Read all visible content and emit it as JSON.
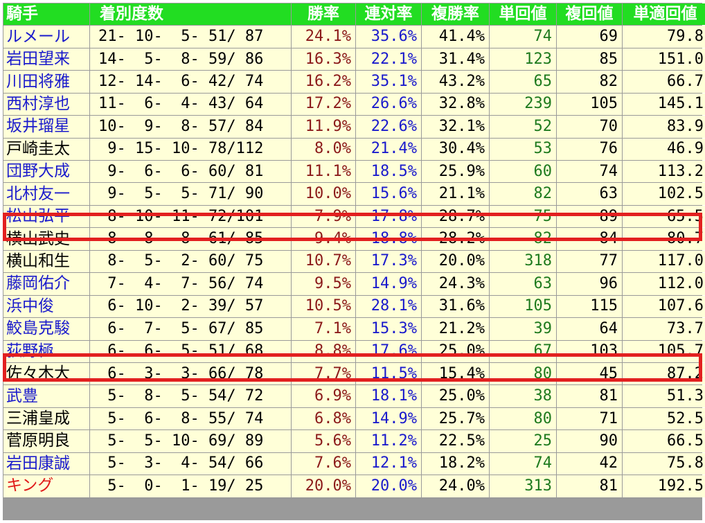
{
  "headers": [
    "騎手",
    "着別度数",
    "勝率",
    "連対率",
    "複勝率",
    "単回値",
    "複回値",
    "単適回値"
  ],
  "colors": {
    "header_bg": "#22dd22",
    "cell_bg": "#ffffd8",
    "highlight": "#e22020",
    "name_blue": "#1a1acc",
    "name_black": "#000000",
    "name_red": "#e01a1a",
    "win_rate": "#8b1a1a",
    "place_rate": "#1a1acc",
    "tan_return": "#1e7a1e"
  },
  "rows": [
    {
      "name": "ルメール",
      "name_color": "blue",
      "record": "21- 10-  5- 51/ 87",
      "win": "24.1%",
      "place": "35.6%",
      "show": "41.4%",
      "tan": "74",
      "fuku": "69",
      "adj": "79.8"
    },
    {
      "name": "岩田望来",
      "name_color": "blue",
      "record": "14-  5-  8- 59/ 86",
      "win": "16.3%",
      "place": "22.1%",
      "show": "31.4%",
      "tan": "123",
      "fuku": "85",
      "adj": "151.0"
    },
    {
      "name": "川田将雅",
      "name_color": "blue",
      "record": "12- 14-  6- 42/ 74",
      "win": "16.2%",
      "place": "35.1%",
      "show": "43.2%",
      "tan": "65",
      "fuku": "82",
      "adj": "66.7"
    },
    {
      "name": "西村淳也",
      "name_color": "blue",
      "record": "11-  6-  4- 43/ 64",
      "win": "17.2%",
      "place": "26.6%",
      "show": "32.8%",
      "tan": "239",
      "fuku": "105",
      "adj": "145.1"
    },
    {
      "name": "坂井瑠星",
      "name_color": "blue",
      "record": "10-  9-  8- 57/ 84",
      "win": "11.9%",
      "place": "22.6%",
      "show": "32.1%",
      "tan": "52",
      "fuku": "70",
      "adj": "83.9"
    },
    {
      "name": "戸崎圭太",
      "name_color": "black",
      "record": " 9- 15- 10- 78/112",
      "win": "8.0%",
      "place": "21.4%",
      "show": "30.4%",
      "tan": "53",
      "fuku": "76",
      "adj": "46.9"
    },
    {
      "name": "団野大成",
      "name_color": "blue",
      "record": " 9-  6-  6- 60/ 81",
      "win": "11.1%",
      "place": "18.5%",
      "show": "25.9%",
      "tan": "60",
      "fuku": "74",
      "adj": "113.2"
    },
    {
      "name": "北村友一",
      "name_color": "blue",
      "record": " 9-  5-  5- 71/ 90",
      "win": "10.0%",
      "place": "15.6%",
      "show": "21.1%",
      "tan": "82",
      "fuku": "63",
      "adj": "102.5"
    },
    {
      "name": "松山弘平",
      "name_color": "blue",
      "record": " 8- 10- 11- 72/101",
      "win": "7.9%",
      "place": "17.8%",
      "show": "28.7%",
      "tan": "75",
      "fuku": "89",
      "adj": "65.5"
    },
    {
      "name": "横山武史",
      "name_color": "black",
      "record": " 8-  8-  8- 61/ 85",
      "win": "9.4%",
      "place": "18.8%",
      "show": "28.2%",
      "tan": "82",
      "fuku": "84",
      "adj": "80.7"
    },
    {
      "name": "横山和生",
      "name_color": "black",
      "record": " 8-  5-  2- 60/ 75",
      "win": "10.7%",
      "place": "17.3%",
      "show": "20.0%",
      "tan": "318",
      "fuku": "77",
      "adj": "117.0"
    },
    {
      "name": "藤岡佑介",
      "name_color": "blue",
      "record": " 7-  4-  7- 56/ 74",
      "win": "9.5%",
      "place": "14.9%",
      "show": "24.3%",
      "tan": "63",
      "fuku": "96",
      "adj": "112.0"
    },
    {
      "name": "浜中俊",
      "name_color": "blue",
      "record": " 6- 10-  2- 39/ 57",
      "win": "10.5%",
      "place": "28.1%",
      "show": "31.6%",
      "tan": "105",
      "fuku": "115",
      "adj": "107.6"
    },
    {
      "name": "鮫島克駿",
      "name_color": "blue",
      "record": " 6-  7-  5- 67/ 85",
      "win": "7.1%",
      "place": "15.3%",
      "show": "21.2%",
      "tan": "39",
      "fuku": "64",
      "adj": "73.7"
    },
    {
      "name": "荻野極",
      "name_color": "blue",
      "record": " 6-  6-  5- 51/ 68",
      "win": "8.8%",
      "place": "17.6%",
      "show": "25.0%",
      "tan": "67",
      "fuku": "103",
      "adj": "105.7"
    },
    {
      "name": "佐々木大",
      "name_color": "black",
      "record": " 6-  3-  3- 66/ 78",
      "win": "7.7%",
      "place": "11.5%",
      "show": "15.4%",
      "tan": "80",
      "fuku": "45",
      "adj": "87.2"
    },
    {
      "name": "武豊",
      "name_color": "blue",
      "record": " 5-  8-  5- 54/ 72",
      "win": "6.9%",
      "place": "18.1%",
      "show": "25.0%",
      "tan": "38",
      "fuku": "81",
      "adj": "51.3"
    },
    {
      "name": "三浦皇成",
      "name_color": "black",
      "record": " 5-  6-  8- 55/ 74",
      "win": "6.8%",
      "place": "14.9%",
      "show": "25.7%",
      "tan": "80",
      "fuku": "71",
      "adj": "52.5"
    },
    {
      "name": "菅原明良",
      "name_color": "black",
      "record": " 5-  5- 10- 69/ 89",
      "win": "5.6%",
      "place": "11.2%",
      "show": "22.5%",
      "tan": "25",
      "fuku": "90",
      "adj": "66.5"
    },
    {
      "name": "岩田康誠",
      "name_color": "blue",
      "record": " 5-  3-  4- 54/ 66",
      "win": "7.6%",
      "place": "12.1%",
      "show": "18.2%",
      "tan": "74",
      "fuku": "42",
      "adj": "75.8"
    },
    {
      "name": "キング",
      "name_color": "red",
      "record": " 5-  0-  1- 19/ 25",
      "win": "20.0%",
      "place": "20.0%",
      "show": "24.0%",
      "tan": "313",
      "fuku": "81",
      "adj": "192.5"
    }
  ],
  "highlighted_rows": [
    8,
    14
  ]
}
